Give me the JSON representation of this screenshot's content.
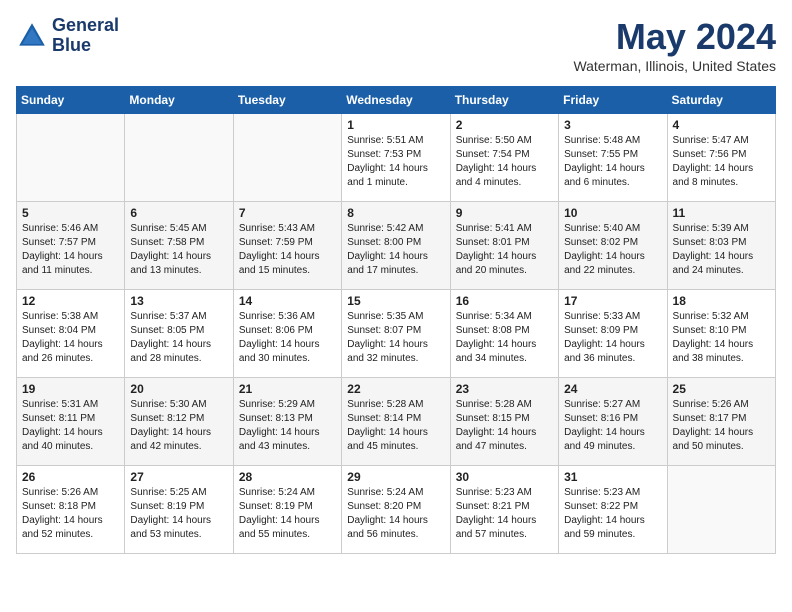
{
  "header": {
    "logo_line1": "General",
    "logo_line2": "Blue",
    "month_title": "May 2024",
    "location": "Waterman, Illinois, United States"
  },
  "weekdays": [
    "Sunday",
    "Monday",
    "Tuesday",
    "Wednesday",
    "Thursday",
    "Friday",
    "Saturday"
  ],
  "weeks": [
    [
      {
        "day": "",
        "info": ""
      },
      {
        "day": "",
        "info": ""
      },
      {
        "day": "",
        "info": ""
      },
      {
        "day": "1",
        "info": "Sunrise: 5:51 AM\nSunset: 7:53 PM\nDaylight: 14 hours\nand 1 minute."
      },
      {
        "day": "2",
        "info": "Sunrise: 5:50 AM\nSunset: 7:54 PM\nDaylight: 14 hours\nand 4 minutes."
      },
      {
        "day": "3",
        "info": "Sunrise: 5:48 AM\nSunset: 7:55 PM\nDaylight: 14 hours\nand 6 minutes."
      },
      {
        "day": "4",
        "info": "Sunrise: 5:47 AM\nSunset: 7:56 PM\nDaylight: 14 hours\nand 8 minutes."
      }
    ],
    [
      {
        "day": "5",
        "info": "Sunrise: 5:46 AM\nSunset: 7:57 PM\nDaylight: 14 hours\nand 11 minutes."
      },
      {
        "day": "6",
        "info": "Sunrise: 5:45 AM\nSunset: 7:58 PM\nDaylight: 14 hours\nand 13 minutes."
      },
      {
        "day": "7",
        "info": "Sunrise: 5:43 AM\nSunset: 7:59 PM\nDaylight: 14 hours\nand 15 minutes."
      },
      {
        "day": "8",
        "info": "Sunrise: 5:42 AM\nSunset: 8:00 PM\nDaylight: 14 hours\nand 17 minutes."
      },
      {
        "day": "9",
        "info": "Sunrise: 5:41 AM\nSunset: 8:01 PM\nDaylight: 14 hours\nand 20 minutes."
      },
      {
        "day": "10",
        "info": "Sunrise: 5:40 AM\nSunset: 8:02 PM\nDaylight: 14 hours\nand 22 minutes."
      },
      {
        "day": "11",
        "info": "Sunrise: 5:39 AM\nSunset: 8:03 PM\nDaylight: 14 hours\nand 24 minutes."
      }
    ],
    [
      {
        "day": "12",
        "info": "Sunrise: 5:38 AM\nSunset: 8:04 PM\nDaylight: 14 hours\nand 26 minutes."
      },
      {
        "day": "13",
        "info": "Sunrise: 5:37 AM\nSunset: 8:05 PM\nDaylight: 14 hours\nand 28 minutes."
      },
      {
        "day": "14",
        "info": "Sunrise: 5:36 AM\nSunset: 8:06 PM\nDaylight: 14 hours\nand 30 minutes."
      },
      {
        "day": "15",
        "info": "Sunrise: 5:35 AM\nSunset: 8:07 PM\nDaylight: 14 hours\nand 32 minutes."
      },
      {
        "day": "16",
        "info": "Sunrise: 5:34 AM\nSunset: 8:08 PM\nDaylight: 14 hours\nand 34 minutes."
      },
      {
        "day": "17",
        "info": "Sunrise: 5:33 AM\nSunset: 8:09 PM\nDaylight: 14 hours\nand 36 minutes."
      },
      {
        "day": "18",
        "info": "Sunrise: 5:32 AM\nSunset: 8:10 PM\nDaylight: 14 hours\nand 38 minutes."
      }
    ],
    [
      {
        "day": "19",
        "info": "Sunrise: 5:31 AM\nSunset: 8:11 PM\nDaylight: 14 hours\nand 40 minutes."
      },
      {
        "day": "20",
        "info": "Sunrise: 5:30 AM\nSunset: 8:12 PM\nDaylight: 14 hours\nand 42 minutes."
      },
      {
        "day": "21",
        "info": "Sunrise: 5:29 AM\nSunset: 8:13 PM\nDaylight: 14 hours\nand 43 minutes."
      },
      {
        "day": "22",
        "info": "Sunrise: 5:28 AM\nSunset: 8:14 PM\nDaylight: 14 hours\nand 45 minutes."
      },
      {
        "day": "23",
        "info": "Sunrise: 5:28 AM\nSunset: 8:15 PM\nDaylight: 14 hours\nand 47 minutes."
      },
      {
        "day": "24",
        "info": "Sunrise: 5:27 AM\nSunset: 8:16 PM\nDaylight: 14 hours\nand 49 minutes."
      },
      {
        "day": "25",
        "info": "Sunrise: 5:26 AM\nSunset: 8:17 PM\nDaylight: 14 hours\nand 50 minutes."
      }
    ],
    [
      {
        "day": "26",
        "info": "Sunrise: 5:26 AM\nSunset: 8:18 PM\nDaylight: 14 hours\nand 52 minutes."
      },
      {
        "day": "27",
        "info": "Sunrise: 5:25 AM\nSunset: 8:19 PM\nDaylight: 14 hours\nand 53 minutes."
      },
      {
        "day": "28",
        "info": "Sunrise: 5:24 AM\nSunset: 8:19 PM\nDaylight: 14 hours\nand 55 minutes."
      },
      {
        "day": "29",
        "info": "Sunrise: 5:24 AM\nSunset: 8:20 PM\nDaylight: 14 hours\nand 56 minutes."
      },
      {
        "day": "30",
        "info": "Sunrise: 5:23 AM\nSunset: 8:21 PM\nDaylight: 14 hours\nand 57 minutes."
      },
      {
        "day": "31",
        "info": "Sunrise: 5:23 AM\nSunset: 8:22 PM\nDaylight: 14 hours\nand 59 minutes."
      },
      {
        "day": "",
        "info": ""
      }
    ]
  ]
}
